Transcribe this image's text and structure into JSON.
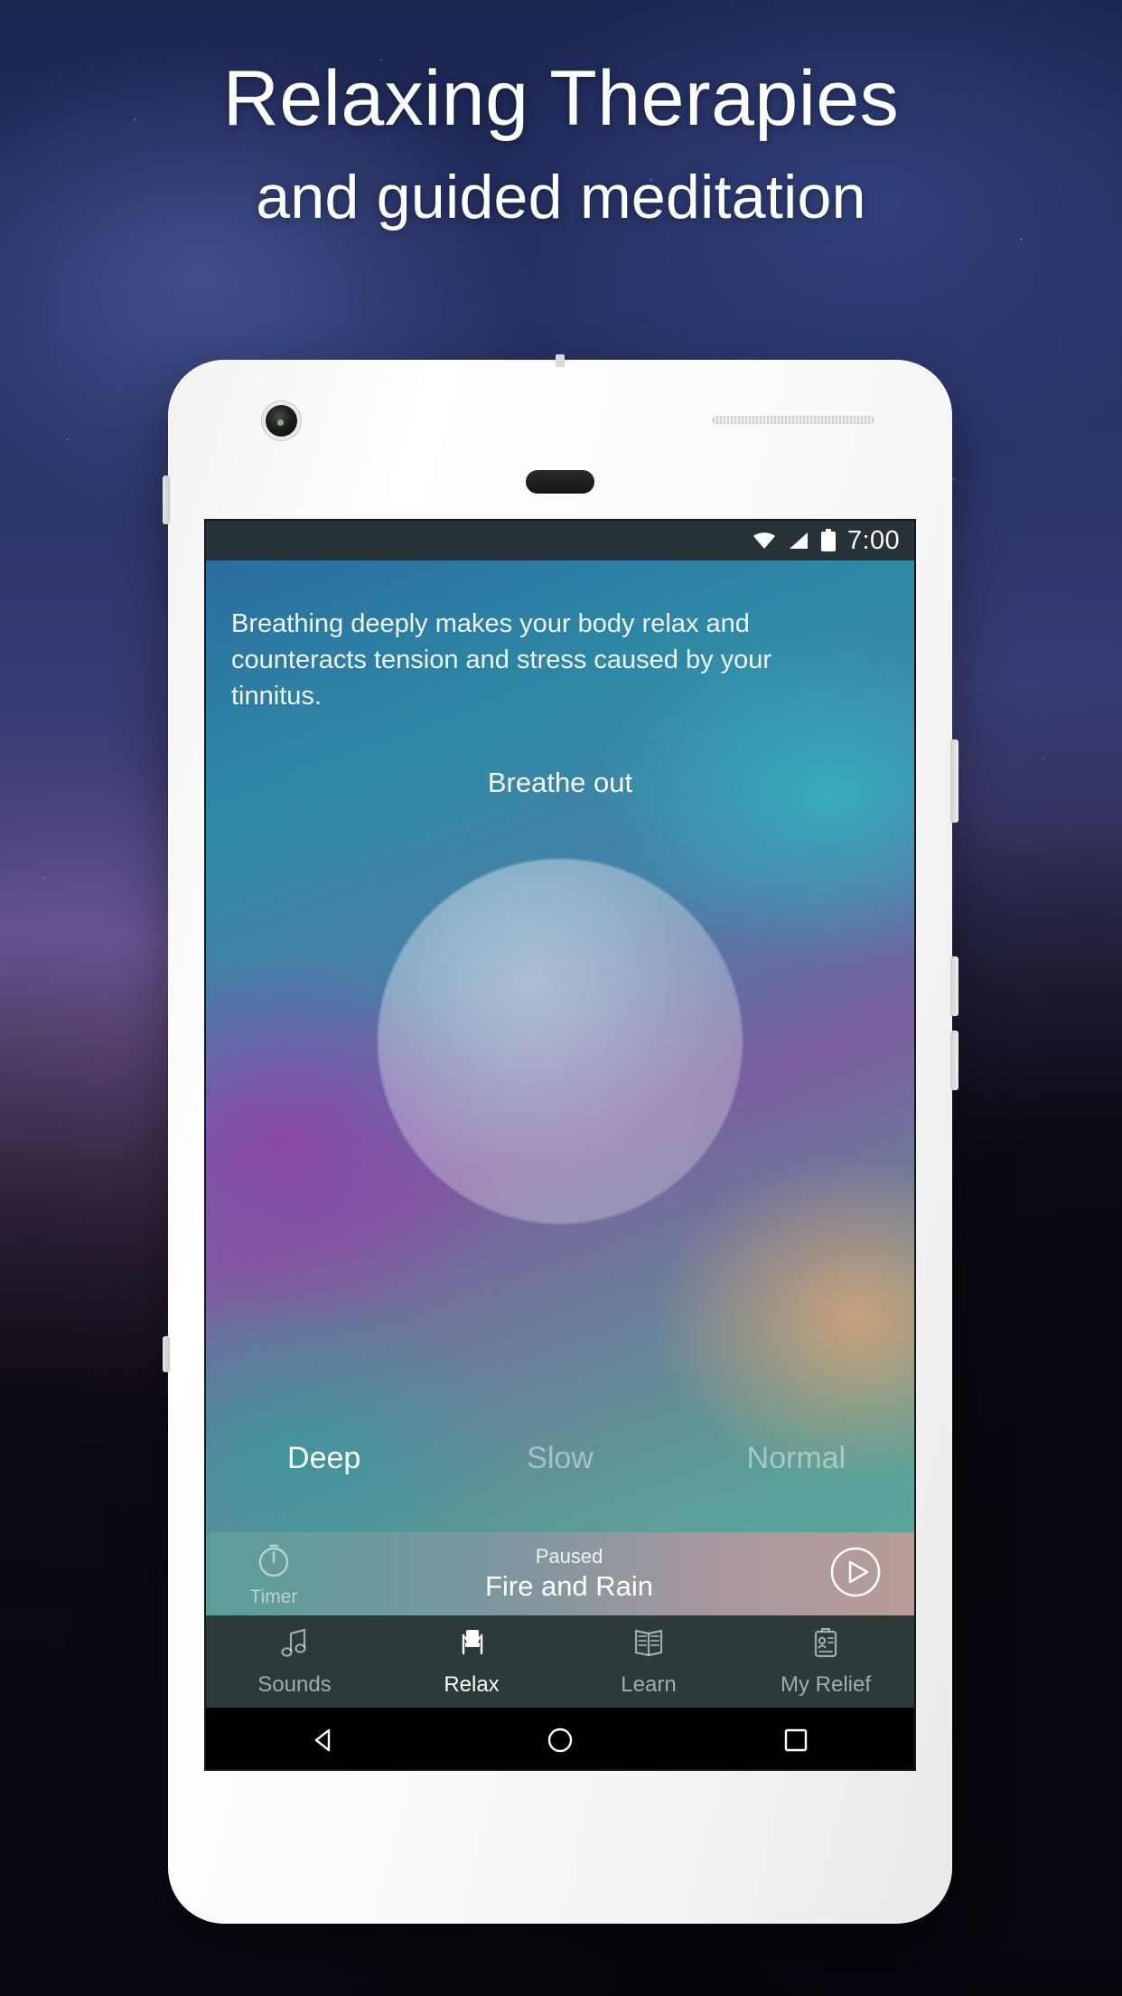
{
  "promo": {
    "headline_line1": "Relaxing Therapies",
    "headline_line2": "and guided meditation"
  },
  "phone": {
    "status_bar": {
      "time": "7:00",
      "icons": [
        "wifi-icon",
        "cellular-signal-icon",
        "battery-icon"
      ]
    },
    "app": {
      "intro_text": "Breathing deeply makes your body relax and counteracts tension and stress caused by your tinnitus.",
      "breath_state_label": "Breathe out",
      "breathing_modes": [
        {
          "label": "Deep",
          "active": true
        },
        {
          "label": "Slow",
          "active": false
        },
        {
          "label": "Normal",
          "active": false
        }
      ],
      "player": {
        "timer_label": "Timer",
        "state_label": "Paused",
        "track_title": "Fire and Rain",
        "play_button_label": "Play"
      },
      "tabs": [
        {
          "label": "Sounds",
          "icon": "music-note-icon",
          "active": false
        },
        {
          "label": "Relax",
          "icon": "armchair-icon",
          "active": true
        },
        {
          "label": "Learn",
          "icon": "open-book-icon",
          "active": false
        },
        {
          "label": "My Relief",
          "icon": "clipboard-person-icon",
          "active": false
        }
      ]
    },
    "android_nav": {
      "back": "back-triangle-icon",
      "home": "home-circle-icon",
      "recents": "recents-square-icon"
    }
  },
  "colors": {
    "status_bar_bg": "#263238",
    "tab_bar_bg": "#2d3a3a",
    "nav_bar_bg": "#000000",
    "accent_white": "#ffffff",
    "backdrop_deep_blue": "#1b2550"
  }
}
